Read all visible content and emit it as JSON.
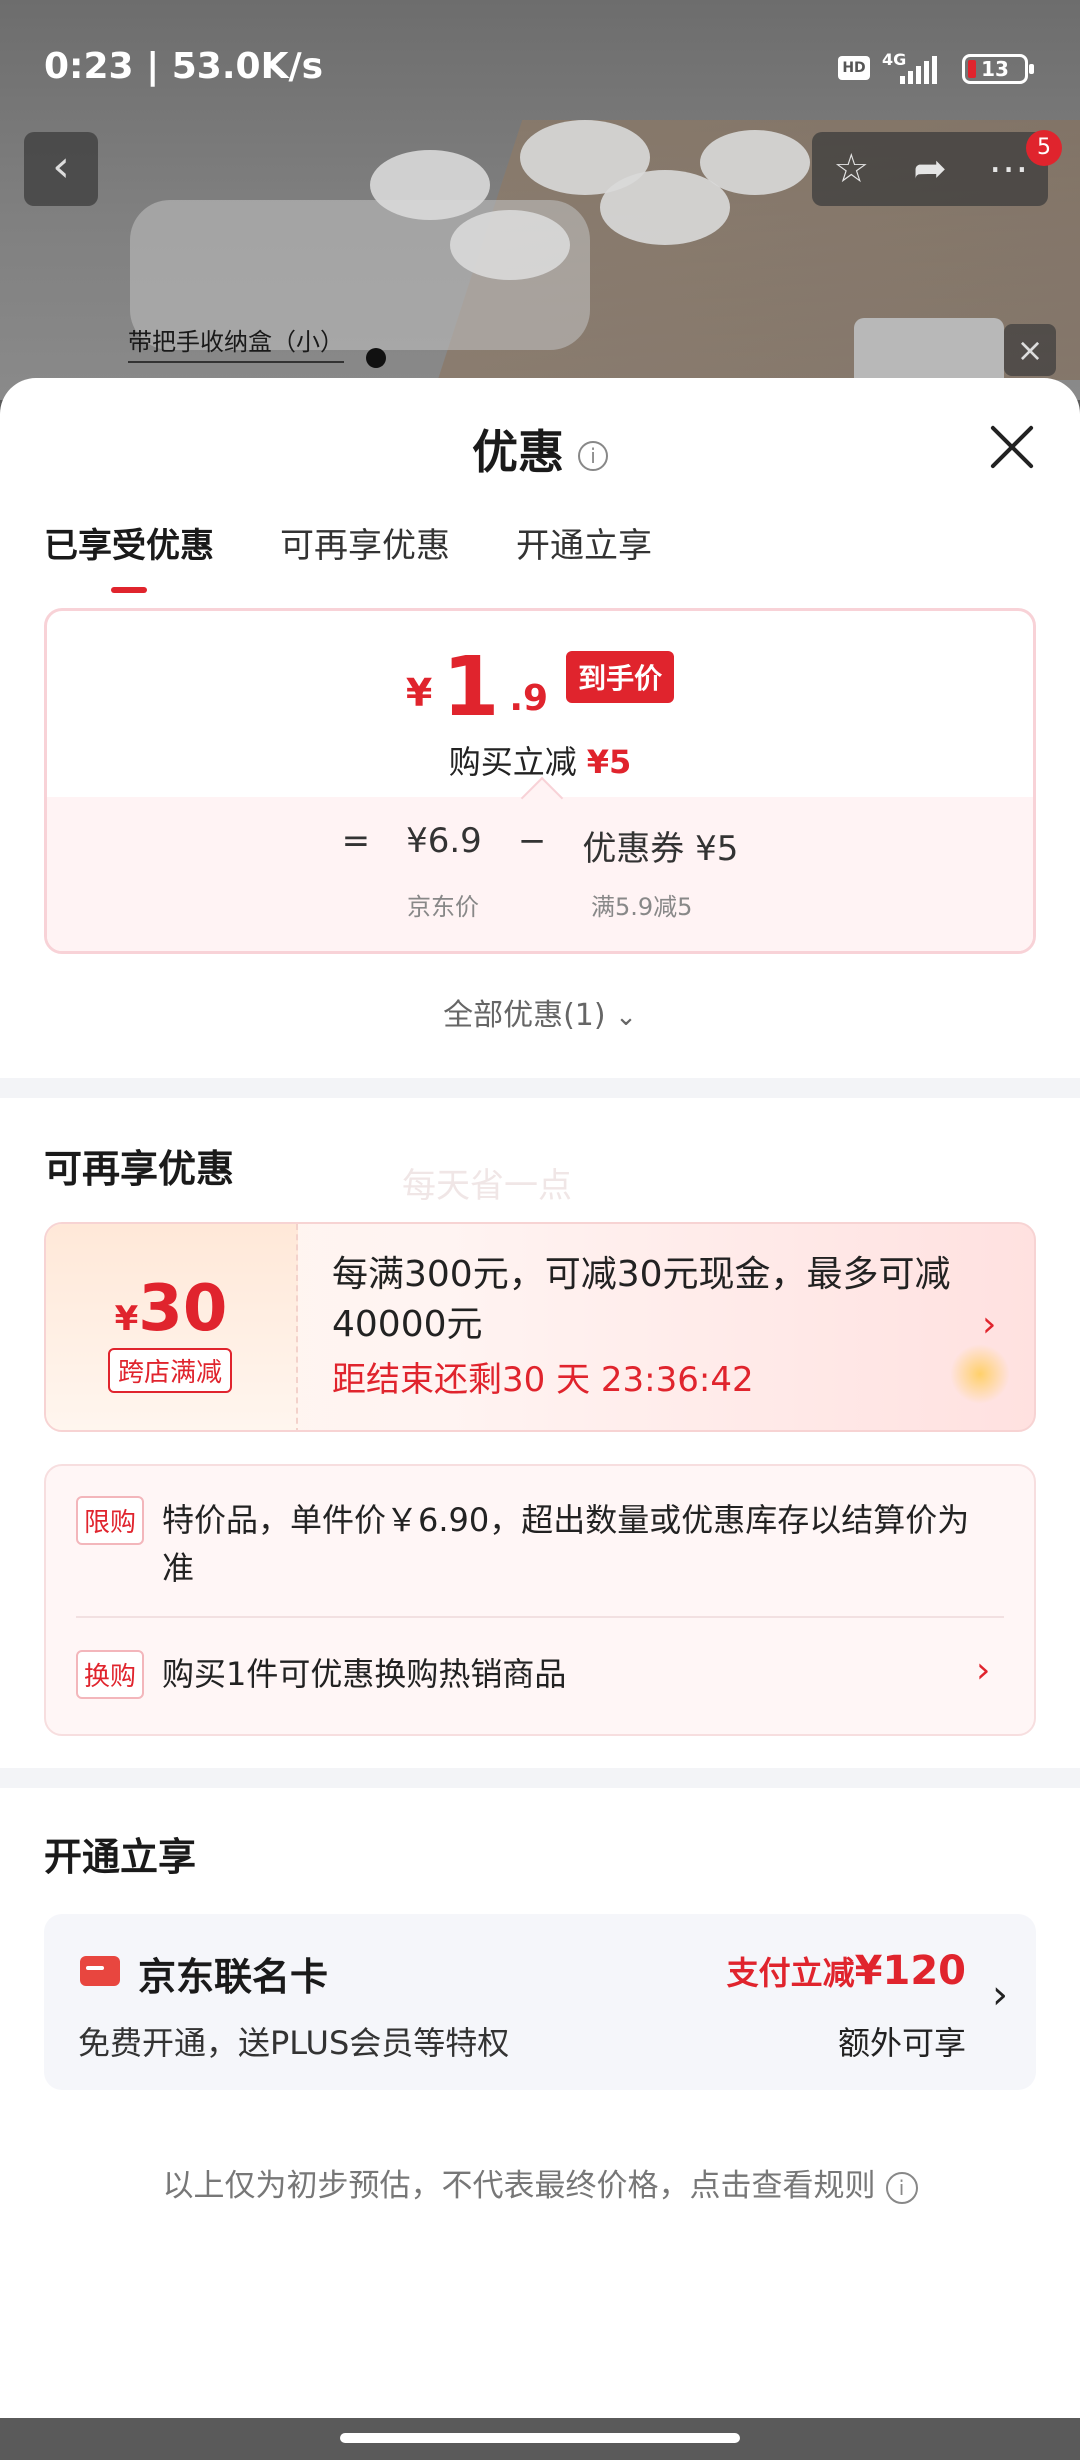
{
  "status_bar": {
    "time_speed": "0:23 | 53.0K/s",
    "hd": "HD",
    "network": "4G",
    "battery": "13"
  },
  "background": {
    "product_label": "带把手收纳盒（小）"
  },
  "nav": {
    "back_icon": "‹",
    "badge_count": "5",
    "close_float": "×"
  },
  "sheet": {
    "title": "优惠",
    "tabs": [
      "已享受优惠",
      "可再享优惠",
      "开通立享"
    ],
    "active_tab": 0
  },
  "price_card": {
    "yen": "¥",
    "integer": "1",
    "decimal": ".9",
    "tag": "到手价",
    "subtitle": "购买立减",
    "subtitle_amount": "¥5",
    "equals": "=",
    "jd_price": "¥6.9",
    "minus": "−",
    "coupon_label": "优惠券 ¥5",
    "jd_price_caption": "京东价",
    "coupon_caption": "满5.9减5"
  },
  "all_offers": "全部优惠(1)",
  "reenjoy": {
    "title": "可再享优惠",
    "watermark": "每天省一点",
    "coupon": {
      "yen": "¥",
      "amount": "30",
      "badge": "跨店满减",
      "text": "每满300元，可减30元现金，最多可减40000元",
      "timer": "距结束还剩30 天 23:36:42"
    },
    "limits": [
      {
        "badge": "限购",
        "text": "特价品，单件价￥6.90，超出数量或优惠库存以结算价为准"
      },
      {
        "badge": "换购",
        "text": "购买1件可优惠换购热销商品"
      }
    ]
  },
  "open_now": {
    "title": "开通立享",
    "card_name": "京东联名卡",
    "card_desc": "免费开通，送PLUS会员等特权",
    "pay_discount_label": "支付立减",
    "pay_discount_amount": "¥120",
    "extra": "额外可享"
  },
  "disclaimer": "以上仅为初步预估，不代表最终价格，点击查看规则",
  "colors": {
    "accent_red": "#e0242d",
    "sheet_bg": "#ffffff",
    "section_divider": "#f3f4f7"
  },
  "icons": [
    "back-icon",
    "star-icon",
    "share-icon",
    "more-icon",
    "info-icon",
    "close-icon",
    "chevron-down-icon",
    "chevron-right-icon",
    "card-icon"
  ]
}
